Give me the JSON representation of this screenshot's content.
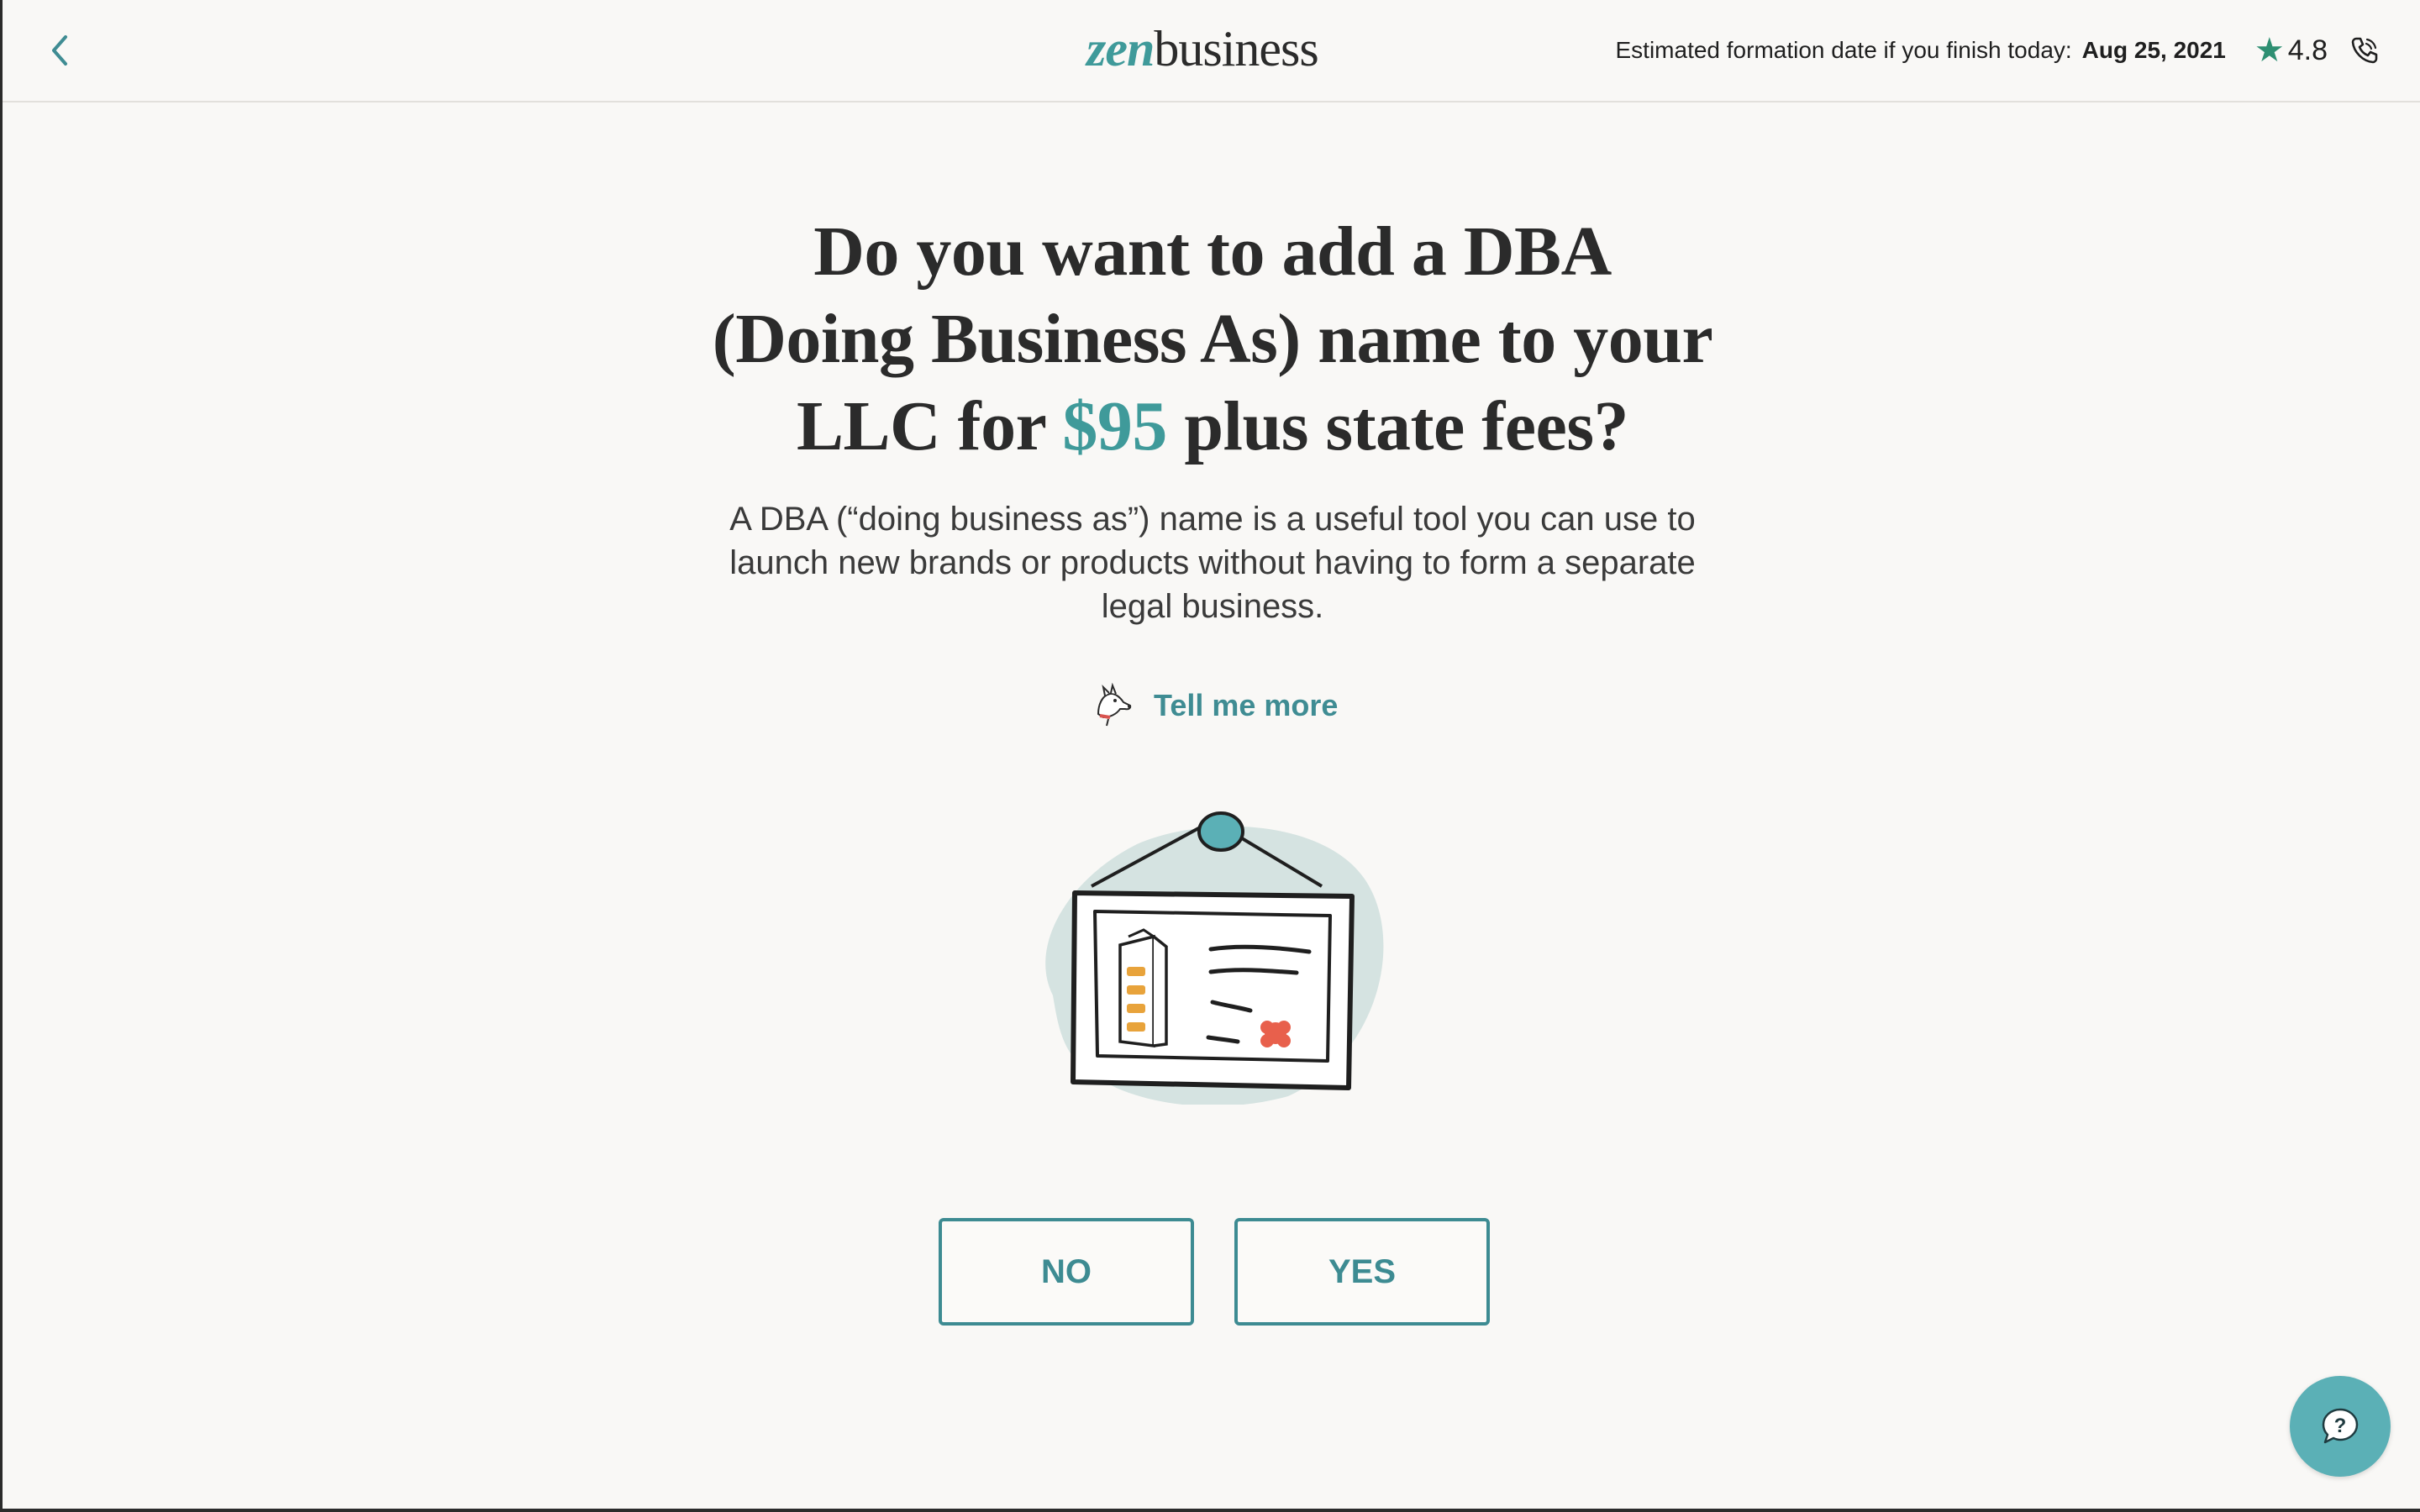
{
  "header": {
    "logo_zen": "zen",
    "logo_business": "business",
    "estimate_label": "Estimated formation date if you finish today:",
    "estimate_date": "Aug 25, 2021",
    "rating": "4.8"
  },
  "main": {
    "headline_part1": "Do you want to add a DBA (Doing Business As) name to your LLC for ",
    "headline_price": "$95",
    "headline_part2": " plus state fees?",
    "description": "A DBA (“doing business as”) name is a useful tool you can use to launch new brands or products without having to form a separate legal business.",
    "tell_more": "Tell me more",
    "no_label": "NO",
    "yes_label": "YES"
  },
  "icons": {
    "back": "chevron-left-icon",
    "star": "star-icon",
    "phone": "phone-icon",
    "help": "chat-help-icon",
    "mascot": "dog-mascot-icon"
  },
  "colors": {
    "accent": "#3f9a9a",
    "button": "#3d8b92",
    "help_bubble": "#5bb0b6",
    "star": "#2e8f72",
    "background": "#f9f8f6"
  }
}
